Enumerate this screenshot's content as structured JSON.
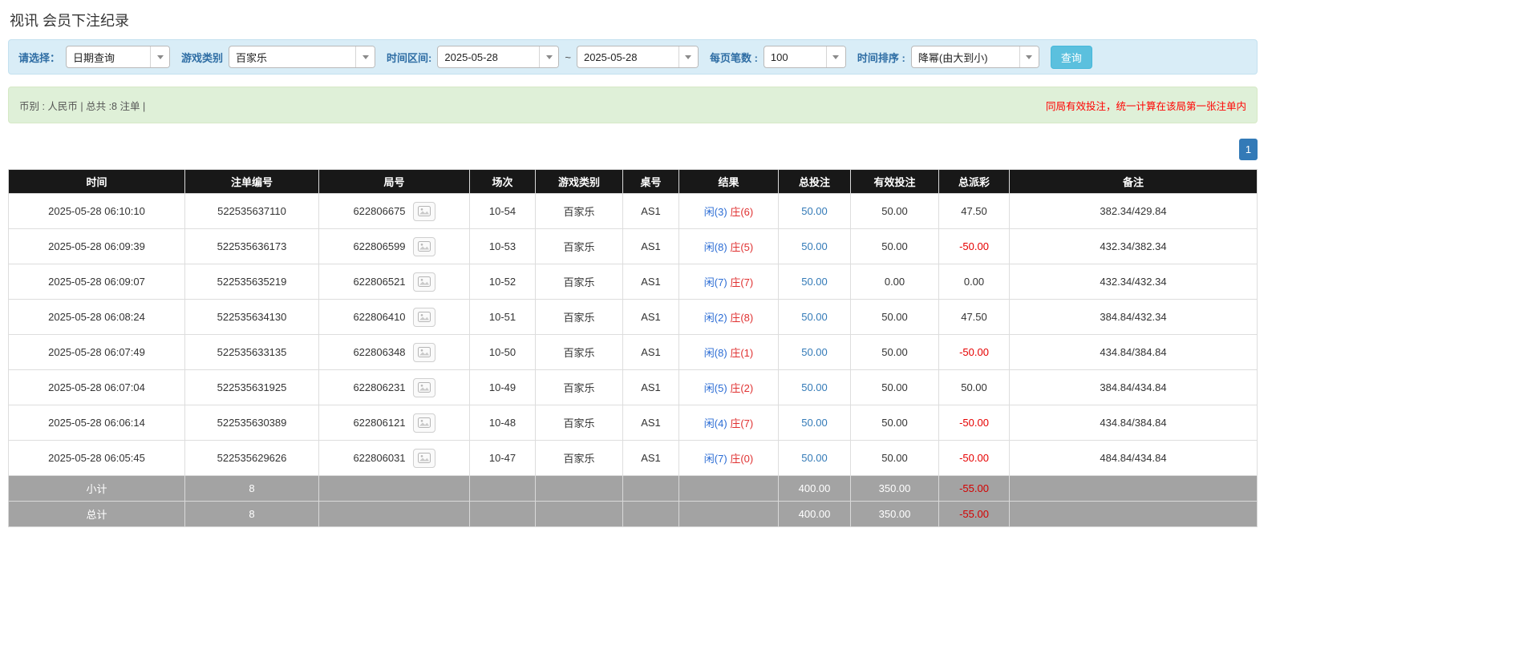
{
  "page": {
    "title": "视讯 会员下注纪录"
  },
  "filters": {
    "select_label": "请选择：",
    "select_value": "日期查询",
    "game_type_label": "游戏类别",
    "game_type_value": "百家乐",
    "time_range_label": "时间区间:",
    "date_from": "2025-05-28",
    "date_to": "2025-05-28",
    "range_separator": "~",
    "page_size_label": "每页笔数 :",
    "page_size_value": "100",
    "sort_label": "时间排序 :",
    "sort_value": "降幂(由大到小)",
    "search_button": "查询"
  },
  "summary": {
    "left_text": "币别 : 人民币 | 总共 :8 注单 |",
    "right_note": "同局有效投注，统一计算在该局第一张注单内"
  },
  "pagination": {
    "current": "1"
  },
  "icons": {
    "caret_down": "css-triangle-down",
    "snapshot": "photo-frame-svg"
  },
  "table": {
    "headers": [
      "时间",
      "注单编号",
      "局号",
      "场次",
      "游戏类别",
      "桌号",
      "结果",
      "总投注",
      "有效投注",
      "总派彩",
      "备注"
    ],
    "rows": [
      {
        "time": "2025-05-28 06:10:10",
        "bet_id": "522535637110",
        "round_id": "622806675",
        "session": "10-54",
        "game": "百家乐",
        "table_no": "AS1",
        "result_player": "闲(3)",
        "result_banker": "庄(6)",
        "total_bet": "50.00",
        "valid_bet": "50.00",
        "payout": "47.50",
        "note": "382.34/429.84"
      },
      {
        "time": "2025-05-28 06:09:39",
        "bet_id": "522535636173",
        "round_id": "622806599",
        "session": "10-53",
        "game": "百家乐",
        "table_no": "AS1",
        "result_player": "闲(8)",
        "result_banker": "庄(5)",
        "total_bet": "50.00",
        "valid_bet": "50.00",
        "payout": "-50.00",
        "note": "432.34/382.34"
      },
      {
        "time": "2025-05-28 06:09:07",
        "bet_id": "522535635219",
        "round_id": "622806521",
        "session": "10-52",
        "game": "百家乐",
        "table_no": "AS1",
        "result_player": "闲(7)",
        "result_banker": "庄(7)",
        "total_bet": "50.00",
        "valid_bet": "0.00",
        "payout": "0.00",
        "note": "432.34/432.34"
      },
      {
        "time": "2025-05-28 06:08:24",
        "bet_id": "522535634130",
        "round_id": "622806410",
        "session": "10-51",
        "game": "百家乐",
        "table_no": "AS1",
        "result_player": "闲(2)",
        "result_banker": "庄(8)",
        "total_bet": "50.00",
        "valid_bet": "50.00",
        "payout": "47.50",
        "note": "384.84/432.34"
      },
      {
        "time": "2025-05-28 06:07:49",
        "bet_id": "522535633135",
        "round_id": "622806348",
        "session": "10-50",
        "game": "百家乐",
        "table_no": "AS1",
        "result_player": "闲(8)",
        "result_banker": "庄(1)",
        "total_bet": "50.00",
        "valid_bet": "50.00",
        "payout": "-50.00",
        "note": "434.84/384.84"
      },
      {
        "time": "2025-05-28 06:07:04",
        "bet_id": "522535631925",
        "round_id": "622806231",
        "session": "10-49",
        "game": "百家乐",
        "table_no": "AS1",
        "result_player": "闲(5)",
        "result_banker": "庄(2)",
        "total_bet": "50.00",
        "valid_bet": "50.00",
        "payout": "50.00",
        "note": "384.84/434.84"
      },
      {
        "time": "2025-05-28 06:06:14",
        "bet_id": "522535630389",
        "round_id": "622806121",
        "session": "10-48",
        "game": "百家乐",
        "table_no": "AS1",
        "result_player": "闲(4)",
        "result_banker": "庄(7)",
        "total_bet": "50.00",
        "valid_bet": "50.00",
        "payout": "-50.00",
        "note": "434.84/384.84"
      },
      {
        "time": "2025-05-28 06:05:45",
        "bet_id": "522535629626",
        "round_id": "622806031",
        "session": "10-47",
        "game": "百家乐",
        "table_no": "AS1",
        "result_player": "闲(7)",
        "result_banker": "庄(0)",
        "total_bet": "50.00",
        "valid_bet": "50.00",
        "payout": "-50.00",
        "note": "484.84/434.84"
      }
    ],
    "subtotal": {
      "label": "小计",
      "count": "8",
      "total_bet": "400.00",
      "valid_bet": "350.00",
      "payout": "-55.00"
    },
    "total": {
      "label": "总计",
      "count": "8",
      "total_bet": "400.00",
      "valid_bet": "350.00",
      "payout": "-55.00"
    }
  }
}
